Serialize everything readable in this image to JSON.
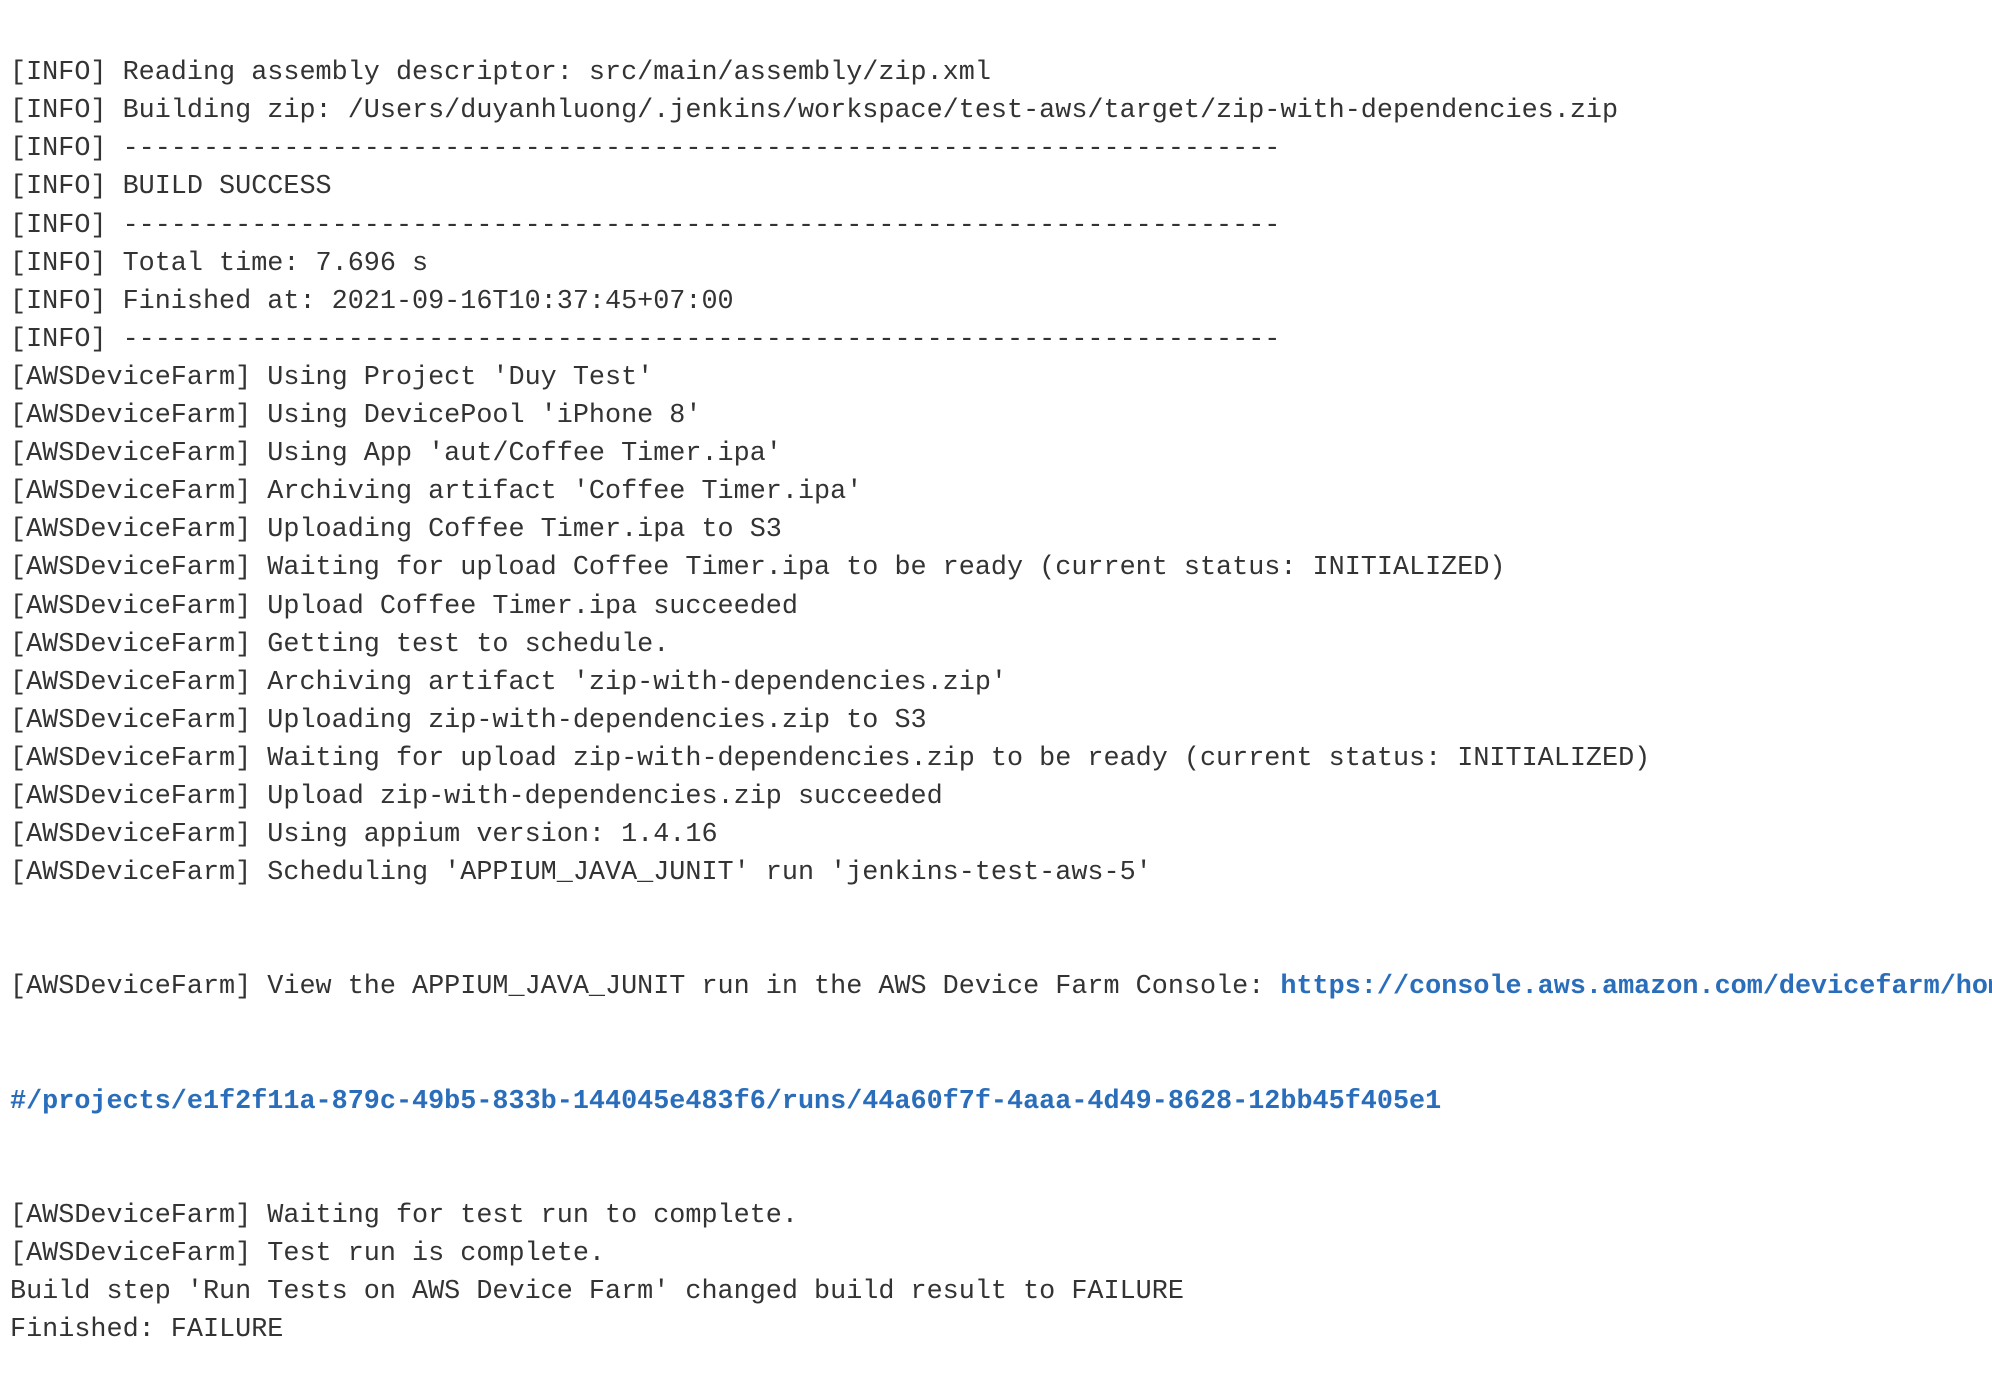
{
  "console": {
    "lines_before_link": [
      "[INFO] Reading assembly descriptor: src/main/assembly/zip.xml",
      "[INFO] Building zip: /Users/duyanhluong/.jenkins/workspace/test-aws/target/zip-with-dependencies.zip",
      "[INFO] ------------------------------------------------------------------------",
      "[INFO] BUILD SUCCESS",
      "[INFO] ------------------------------------------------------------------------",
      "[INFO] Total time: 7.696 s",
      "[INFO] Finished at: 2021-09-16T10:37:45+07:00",
      "[INFO] ------------------------------------------------------------------------",
      "[AWSDeviceFarm] Using Project 'Duy Test'",
      "[AWSDeviceFarm] Using DevicePool 'iPhone 8'",
      "[AWSDeviceFarm] Using App 'aut/Coffee Timer.ipa'",
      "[AWSDeviceFarm] Archiving artifact 'Coffee Timer.ipa'",
      "[AWSDeviceFarm] Uploading Coffee Timer.ipa to S3",
      "[AWSDeviceFarm] Waiting for upload Coffee Timer.ipa to be ready (current status: INITIALIZED)",
      "[AWSDeviceFarm] Upload Coffee Timer.ipa succeeded",
      "[AWSDeviceFarm] Getting test to schedule.",
      "[AWSDeviceFarm] Archiving artifact 'zip-with-dependencies.zip'",
      "[AWSDeviceFarm] Uploading zip-with-dependencies.zip to S3",
      "[AWSDeviceFarm] Waiting for upload zip-with-dependencies.zip to be ready (current status: INITIALIZED)",
      "[AWSDeviceFarm] Upload zip-with-dependencies.zip succeeded",
      "[AWSDeviceFarm] Using appium version: 1.4.16",
      "[AWSDeviceFarm] Scheduling 'APPIUM_JAVA_JUNIT' run 'jenkins-test-aws-5'"
    ],
    "link_line_prefix": "[AWSDeviceFarm] View the APPIUM_JAVA_JUNIT run in the AWS Device Farm Console: ",
    "link_part1": "https://console.aws.amazon.com/devicefarm/home",
    "link_part2": "#/projects/e1f2f11a-879c-49b5-833b-144045e483f6/runs/44a60f7f-4aaa-4d49-8628-12bb45f405e1",
    "lines_after_link": [
      "[AWSDeviceFarm] Waiting for test run to complete.",
      "[AWSDeviceFarm] Test run is complete.",
      "Build step 'Run Tests on AWS Device Farm' changed build result to FAILURE",
      "Finished: FAILURE"
    ],
    "link_color": "#2a6ebb"
  }
}
